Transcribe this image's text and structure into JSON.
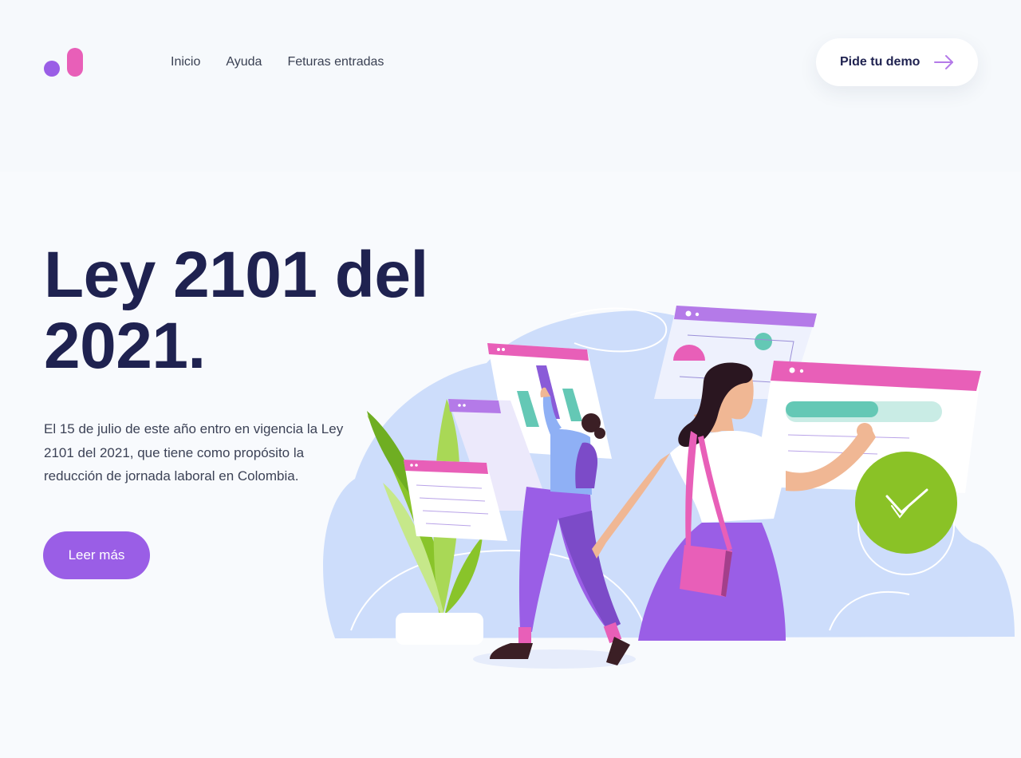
{
  "header": {
    "nav": [
      {
        "label": "Inicio"
      },
      {
        "label": "Ayuda"
      },
      {
        "label": "Feturas entradas"
      }
    ],
    "demo_button": {
      "label": "Pide tu demo",
      "icon": "arrow-right-icon"
    }
  },
  "hero": {
    "title": "Ley 2101 del 2021.",
    "description": "El 15 de julio de este año entro en vigencia la Ley 2101 del 2021, que tiene como propósito la reducción de jornada laboral en Colombia.",
    "button_label": "Leer más"
  },
  "colors": {
    "brand_purple": "#9a5ee6",
    "brand_pink": "#e85fb8",
    "heading_navy": "#1f2250",
    "success_green": "#8ac226",
    "teal": "#64c8b5",
    "blob_blue": "#cdddfb"
  }
}
